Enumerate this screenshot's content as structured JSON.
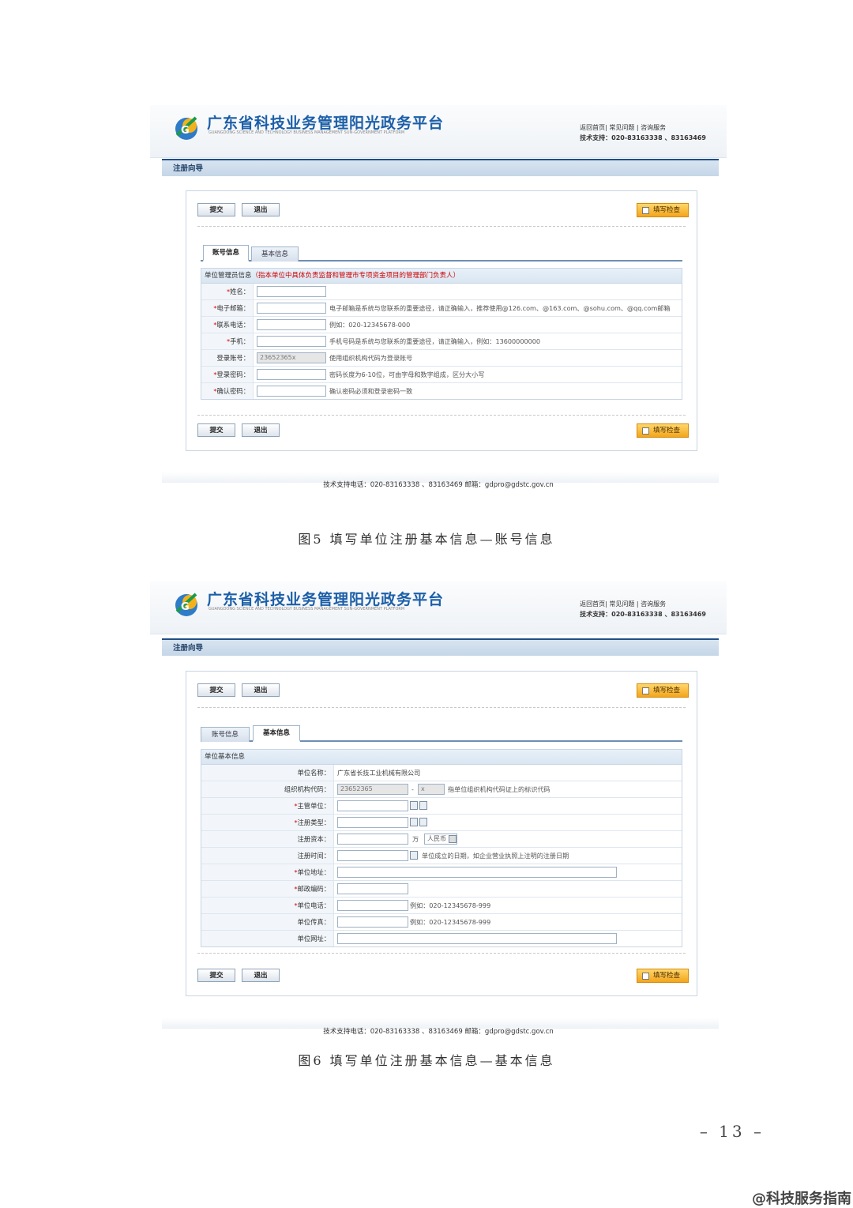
{
  "platform": {
    "title": "广东省科技业务管理阳光政务平台",
    "subtitle": "GUANGDONG SCIENCE AND TECHNOLOGY BUSINESS MANAGEMENT SUN-GOVERNMENT PLATFORM",
    "links": "返回首页| 常见问题 | 咨询服务",
    "support_label": "技术支持：",
    "support_phone": "020-83163338 、83163469",
    "wizard": "注册向导",
    "submit": "提交",
    "exit": "退出",
    "check": "填写检查",
    "footer": "技术支持电话：020-83163338 、83163469  邮箱：gdpro@gdstc.gov.cn"
  },
  "tabs": {
    "account": "账号信息",
    "basic": "基本信息"
  },
  "account_form": {
    "header": "单位管理员信息",
    "header_note": "（指本单位中具体负责监督和管理市专项资金项目的管理部门负责人）",
    "rows": [
      {
        "label": "姓名：",
        "required": "*",
        "value": "",
        "hint": ""
      },
      {
        "label": "电子邮箱：",
        "required": "*",
        "value": "",
        "hint": "电子邮箱是系统与您联系的重要途径，请正确输入，推荐使用@126.com、@163.com、@sohu.com、@qq.com邮箱"
      },
      {
        "label": "联系电话：",
        "required": "*",
        "value": "",
        "hint": "例如：020-12345678-000"
      },
      {
        "label": "手机：",
        "required": "*",
        "value": "",
        "hint": "手机号码是系统与您联系的重要途径，请正确输入，例如：13600000000"
      },
      {
        "label": "登录账号：",
        "required": "",
        "value": "23652365x",
        "hint": "使用组织机构代码为登录账号"
      },
      {
        "label": "登录密码：",
        "required": "*",
        "value": "",
        "hint": "密码长度为6-10位，可由字母和数字组成，区分大小写"
      },
      {
        "label": "确认密码：",
        "required": "*",
        "value": "",
        "hint": "确认密码必须和登录密码一致"
      }
    ]
  },
  "basic_form": {
    "header": "单位基本信息",
    "name_label": "单位名称：",
    "name_value": "广东省长技工业机械有限公司",
    "org_label": "组织机构代码：",
    "org_value": "23652365",
    "org_dash": "-",
    "org_suffix": "x",
    "org_hint": "指单位组织机构代码证上的标识代码",
    "dept_label": "主管单位：",
    "type_label": "注册类型：",
    "capital_label": "注册资本：",
    "capital_unit": "万",
    "currency": "人民币",
    "date_label": "注册时间：",
    "date_hint": "单位成立的日期，如企业营业执照上注明的注册日期",
    "address_label": "单位地址：",
    "postcode_label": "邮政编码：",
    "phone_label": "单位电话：",
    "phone_hint": "例如：020-12345678-999",
    "fax_label": "单位传真：",
    "fax_hint": "例如：020-12345678-999",
    "web_label": "单位网址：",
    "required": "*"
  },
  "captions": {
    "fig5": "图5 填写单位注册基本信息—账号信息",
    "fig6": "图6 填写单位注册基本信息—基本信息"
  },
  "page_number": "– 13 –",
  "watermark": "@科技服务指南",
  "colors": {
    "brand": "#1c5fa8",
    "wizard_border": "#1f4f86",
    "orange_button": "#f3a51c",
    "required": "#d00000"
  }
}
